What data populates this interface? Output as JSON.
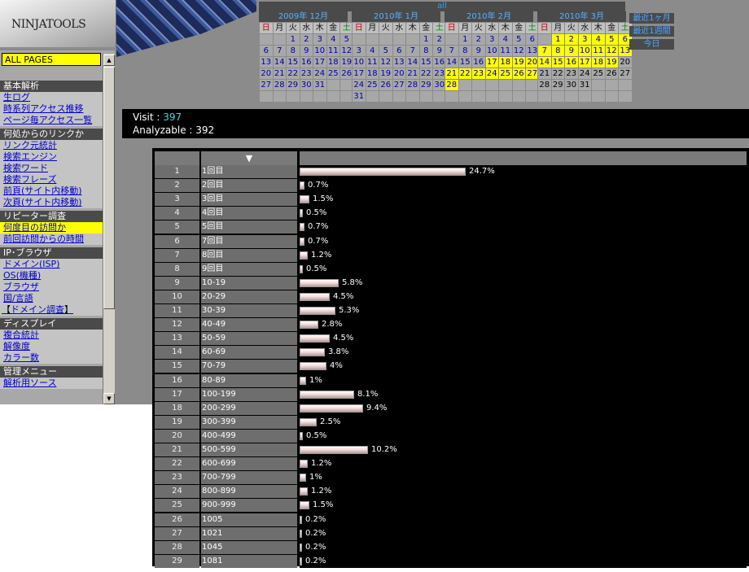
{
  "logo": {
    "text": "NINJATOOLS"
  },
  "sidebar": {
    "selected_page": "ALL PAGES",
    "scroll_up": "▲",
    "scroll_down": "▼",
    "sections": [
      {
        "title": "基本解析",
        "items": [
          {
            "label": "生ログ"
          },
          {
            "label": "時系列アクセス推移"
          },
          {
            "label": "ページ毎アクセス一覧"
          }
        ]
      },
      {
        "title": "何処からのリンクか",
        "items": [
          {
            "label": "リンク元統計"
          },
          {
            "label": "検索エンジン"
          },
          {
            "label": "検索ワード"
          },
          {
            "label": "検索フレーズ"
          },
          {
            "label": "前頁(サイト内移動)"
          },
          {
            "label": "次頁(サイト内移動)"
          }
        ]
      },
      {
        "title": "リピーター調査",
        "items": [
          {
            "label": "何度目の訪問か",
            "active": true
          },
          {
            "label": "前回訪問からの時間"
          }
        ]
      },
      {
        "title": "IP･ブラウザ",
        "items": [
          {
            "label": "ドメイン(ISP)"
          },
          {
            "label": "OS(機種)"
          },
          {
            "label": "ブラウザ"
          },
          {
            "label": "国/言語"
          },
          {
            "label": "ドメイン調査",
            "bracketed": true
          }
        ]
      },
      {
        "title": "ディスプレイ",
        "items": [
          {
            "label": "複合統計"
          },
          {
            "label": "解像度"
          },
          {
            "label": "カラー数"
          }
        ]
      },
      {
        "title": "管理メニュー",
        "items": [
          {
            "label": "解析用ソース"
          }
        ]
      }
    ]
  },
  "calendar": {
    "all_label": "all",
    "weekdays": [
      "日",
      "月",
      "火",
      "水",
      "木",
      "金",
      "土"
    ],
    "months": [
      {
        "title": "2009年 12月",
        "weeks": [
          [
            "",
            "",
            "1",
            "2",
            "3",
            "4",
            "5"
          ],
          [
            "6",
            "7",
            "8",
            "9",
            "10",
            "11",
            "12"
          ],
          [
            "13",
            "14",
            "15",
            "16",
            "17",
            "18",
            "19"
          ],
          [
            "20",
            "21",
            "22",
            "23",
            "24",
            "25",
            "26"
          ],
          [
            "27",
            "28",
            "29",
            "30",
            "31",
            "",
            ""
          ],
          [
            "",
            "",
            "",
            "",
            "",
            "",
            ""
          ]
        ],
        "highlight": []
      },
      {
        "title": "2010年 1月",
        "weeks": [
          [
            "",
            "",
            "",
            "",
            "",
            "1",
            "2"
          ],
          [
            "3",
            "4",
            "5",
            "6",
            "7",
            "8",
            "9"
          ],
          [
            "10",
            "11",
            "12",
            "13",
            "14",
            "15",
            "16"
          ],
          [
            "17",
            "18",
            "19",
            "20",
            "21",
            "22",
            "23"
          ],
          [
            "24",
            "25",
            "26",
            "27",
            "28",
            "29",
            "30"
          ],
          [
            "31",
            "",
            "",
            "",
            "",
            "",
            ""
          ]
        ],
        "highlight": []
      },
      {
        "title": "2010年 2月",
        "weeks": [
          [
            "",
            "1",
            "2",
            "3",
            "4",
            "5",
            "6"
          ],
          [
            "7",
            "8",
            "9",
            "10",
            "11",
            "12",
            "13"
          ],
          [
            "14",
            "15",
            "16",
            "17",
            "18",
            "19",
            "20"
          ],
          [
            "21",
            "22",
            "23",
            "24",
            "25",
            "26",
            "27"
          ],
          [
            "28",
            "",
            "",
            "",
            "",
            "",
            ""
          ],
          [
            "",
            "",
            "",
            "",
            "",
            "",
            ""
          ]
        ],
        "highlight": [
          "17",
          "18",
          "19",
          "20",
          "21",
          "22",
          "23",
          "24",
          "25",
          "26",
          "27",
          "28"
        ]
      },
      {
        "title": "2010年 3月",
        "weeks": [
          [
            "",
            "1",
            "2",
            "3",
            "4",
            "5",
            "6"
          ],
          [
            "7",
            "8",
            "9",
            "10",
            "11",
            "12",
            "13"
          ],
          [
            "14",
            "15",
            "16",
            "17",
            "18",
            "19",
            "20"
          ],
          [
            "21",
            "22",
            "23",
            "24",
            "25",
            "26",
            "27"
          ],
          [
            "28",
            "29",
            "30",
            "31",
            "",
            "",
            ""
          ],
          [
            "",
            "",
            "",
            "",
            "",
            "",
            ""
          ]
        ],
        "highlight": [
          "1",
          "2",
          "3",
          "4",
          "5",
          "6",
          "7",
          "8",
          "9",
          "10",
          "11",
          "12",
          "13",
          "14",
          "15",
          "16",
          "17",
          "18",
          "19"
        ]
      }
    ],
    "quick_links": [
      "最近1ヶ月",
      "最近1週間",
      "今日"
    ]
  },
  "summary": {
    "visit_label": "Visit : ",
    "visit_value": "397",
    "analyzable_label": "Analyzable : ",
    "analyzable_value": "392"
  },
  "table": {
    "sort_indicator": "▼",
    "rows": [
      {
        "num": "1",
        "label": "1回目",
        "pct": 24.7
      },
      {
        "num": "2",
        "label": "2回目",
        "pct": 0.7
      },
      {
        "num": "3",
        "label": "3回目",
        "pct": 1.5
      },
      {
        "num": "4",
        "label": "4回目",
        "pct": 0.5
      },
      {
        "num": "5",
        "label": "5回目",
        "pct": 0.7
      },
      {
        "num": "6",
        "label": "7回目",
        "pct": 0.7
      },
      {
        "num": "7",
        "label": "8回目",
        "pct": 1.2
      },
      {
        "num": "8",
        "label": "9回目",
        "pct": 0.5
      },
      {
        "num": "9",
        "label": "10-19",
        "pct": 5.8
      },
      {
        "num": "10",
        "label": "20-29",
        "pct": 4.5
      },
      {
        "num": "11",
        "label": "30-39",
        "pct": 5.3
      },
      {
        "num": "12",
        "label": "40-49",
        "pct": 2.8
      },
      {
        "num": "13",
        "label": "50-59",
        "pct": 4.5
      },
      {
        "num": "14",
        "label": "60-69",
        "pct": 3.8
      },
      {
        "num": "15",
        "label": "70-79",
        "pct": 4
      },
      {
        "num": "16",
        "label": "80-89",
        "pct": 1
      },
      {
        "num": "17",
        "label": "100-199",
        "pct": 8.1
      },
      {
        "num": "18",
        "label": "200-299",
        "pct": 9.4
      },
      {
        "num": "19",
        "label": "300-399",
        "pct": 2.5
      },
      {
        "num": "20",
        "label": "400-499",
        "pct": 0.5
      },
      {
        "num": "21",
        "label": "500-599",
        "pct": 10.2
      },
      {
        "num": "22",
        "label": "600-699",
        "pct": 1.2
      },
      {
        "num": "23",
        "label": "700-799",
        "pct": 1
      },
      {
        "num": "24",
        "label": "800-899",
        "pct": 1.2
      },
      {
        "num": "25",
        "label": "900-999",
        "pct": 1.5
      },
      {
        "num": "26",
        "label": "1005",
        "pct": 0.2
      },
      {
        "num": "27",
        "label": "1021",
        "pct": 0.2
      },
      {
        "num": "28",
        "label": "1045",
        "pct": 0.2
      },
      {
        "num": "29",
        "label": "1081",
        "pct": 0.2
      }
    ]
  }
}
